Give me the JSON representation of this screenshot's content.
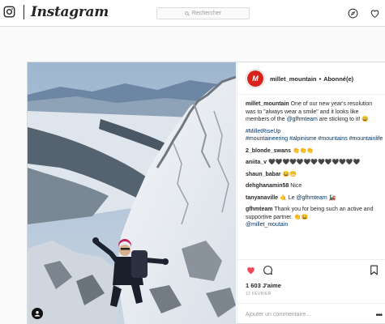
{
  "brand": {
    "wordmark": "Instagram"
  },
  "search": {
    "placeholder": "Rechercher"
  },
  "post": {
    "username": "millet_mountain",
    "follow_status": "Abonné(e)",
    "separator": "•",
    "caption_user": "millet_mountain",
    "caption_text_1": " One of our new year's resolution was to \"always wear a smile\" and it looks like members of the ",
    "caption_mention": "@gfhmteam",
    "caption_text_2": " are sticking to it! 😀",
    "hashtags_1": "#MilletRiseUp",
    "hashtags_2": "#mountaineering #alpinisme #mountains #mountainlife",
    "comments": [
      {
        "user": "2_blonde_swans",
        "text": " 👏👏👏"
      },
      {
        "user": "aniita_v",
        "text": " 🖤🖤🖤🖤🖤🖤🖤🖤🖤🖤🖤🖤🖤"
      },
      {
        "user": "shaun_babar",
        "text": " 😀😁"
      },
      {
        "user": "dehghanamin58",
        "text": " Nice"
      },
      {
        "user": "tanyanaville",
        "text": " 🤙 Le ",
        "mention": "@gfhmteam",
        "tail": " 🚂"
      },
      {
        "user": "gfhmteam",
        "text": " Thank you for being such an active and supportive partner. 👏😀",
        "mention2": "@millet_moutain"
      }
    ],
    "likes": "1 603 J'aime",
    "date": "12 février",
    "add_comment_placeholder": "Ajouter un commentaire...",
    "more": "•••"
  },
  "colors": {
    "like_red": "#ed4956",
    "brand_red": "#d8231d",
    "link": "#003569"
  },
  "icons": [
    "instagram-glyph-icon",
    "search-icon",
    "explore-icon",
    "heart-nav-icon",
    "heart-like-icon",
    "comment-icon",
    "bookmark-icon",
    "user-tag-icon"
  ]
}
